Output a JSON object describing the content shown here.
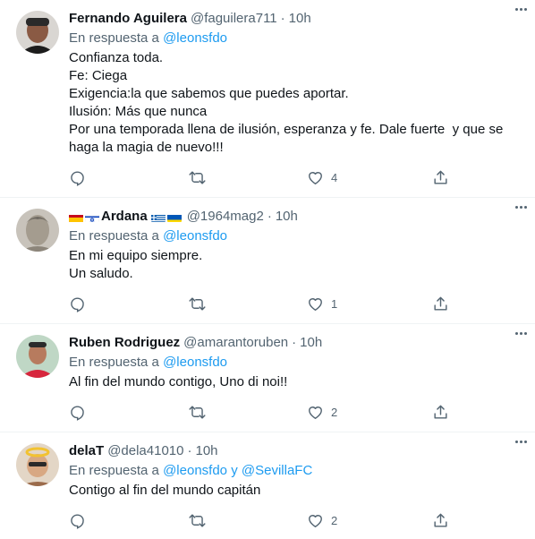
{
  "colors": {
    "link": "#1d9bf0",
    "muted": "#536471",
    "divider": "#eff3f4"
  },
  "reply_prefix": "En respuesta a",
  "tweets": [
    {
      "name": "Fernando Aguilera",
      "handle": "@faguilera711",
      "separator": "·",
      "time": "10h",
      "reply_to": "@leonsfdo",
      "lines": [
        "Confianza toda.",
        "Fe: Ciega",
        "Exigencia:la que sabemos que puedes aportar.",
        "Ilusión: Más que nunca",
        "Por una temporada llena de ilusión, esperanza y fe. Dale fuerte  y que se",
        "haga la magia de nuevo!!!"
      ],
      "likes": "4"
    },
    {
      "name": "Ardana",
      "name_flags_before": [
        "flag-spain-icon",
        "flag-israel-icon"
      ],
      "name_flags_after": [
        "flag-greece-icon",
        "flag-ukraine-icon"
      ],
      "handle": "@1964mag2",
      "separator": "·",
      "time": "10h",
      "reply_to": "@leonsfdo",
      "lines": [
        "En mi equipo siempre.",
        "Un saludo."
      ],
      "likes": "1"
    },
    {
      "name": "Ruben Rodriguez",
      "handle": "@amarantoruben",
      "separator": "·",
      "time": "10h",
      "reply_to": "@leonsfdo",
      "lines": [
        "Al fin del mundo contigo, Uno di noi!!"
      ],
      "likes": "2"
    },
    {
      "name": "delaT",
      "handle": "@dela41010",
      "separator": "·",
      "time": "10h",
      "reply_to": "@leonsfdo",
      "reply_conj": "y",
      "reply_to_2": "@SevillaFC",
      "lines": [
        "Contigo al fin del mundo capitán"
      ],
      "likes": "2"
    }
  ],
  "icons": [
    "reply-icon",
    "retweet-icon",
    "like-icon",
    "share-icon",
    "more-icon"
  ]
}
